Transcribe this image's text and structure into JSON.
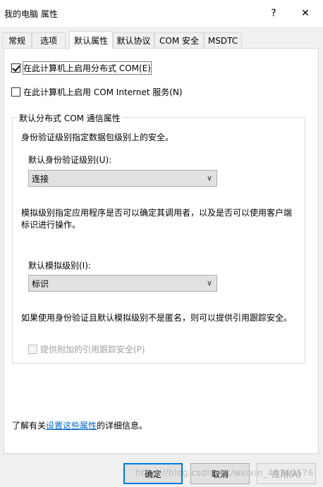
{
  "window": {
    "title": "我的电脑 属性",
    "help_label": "?",
    "close_label": "✕"
  },
  "tabs": [
    {
      "label": "常规"
    },
    {
      "label": "选项"
    },
    {
      "label": "默认属性"
    },
    {
      "label": "默认协议"
    },
    {
      "label": "COM 安全"
    },
    {
      "label": "MSDTC"
    }
  ],
  "options": {
    "enable_dcom": {
      "label": "在此计算机上启用分布式 COM(E)",
      "checked": true
    },
    "enable_com_internet": {
      "label": "在此计算机上启用 COM Internet 服务(N)",
      "checked": false
    }
  },
  "group": {
    "title": "默认分布式 COM 通信属性",
    "auth_desc": "身份验证级别指定数据包级别上的安全。",
    "auth_label": "默认身份验证级别(U):",
    "auth_value": "连接",
    "imp_desc_line1": "模拟级别指定应用程序是否可以确定其调用者，以及是否可以使用客户端",
    "imp_desc_line2": "标识进行操作。",
    "imp_label": "默认模拟级别(I):",
    "imp_value": "标识",
    "ref_desc": "如果使用身份验证且默认模拟级别不是匿名，则可以提供引用跟踪安全。",
    "ref_tracking": {
      "label": "提供附加的引用跟踪安全(P)",
      "checked": false
    }
  },
  "footer": {
    "prefix": "了解有关",
    "link": "设置这些属性",
    "suffix": "的详细信息。"
  },
  "buttons": {
    "ok": "确定",
    "cancel": "取消",
    "apply": "应用(A)"
  },
  "watermark": "https://blog.csdn.net/weixin_48740676"
}
